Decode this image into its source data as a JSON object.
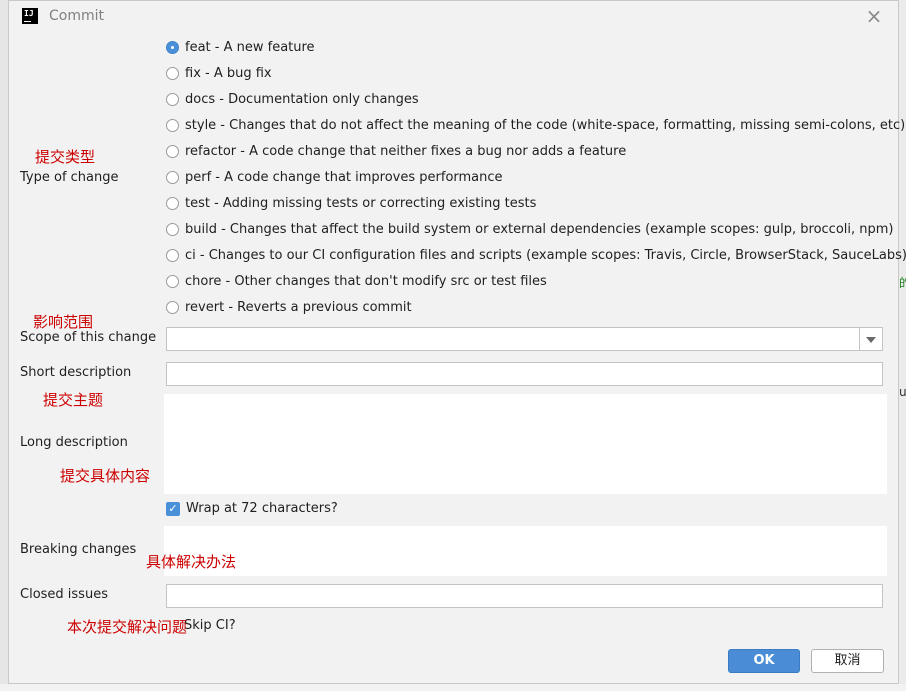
{
  "dialog": {
    "title": "Commit",
    "app_icon_text": "IJ"
  },
  "labels": {
    "type_of_change": "Type of change",
    "scope": "Scope of this change",
    "short_description": "Short description",
    "long_description": "Long description",
    "breaking_changes": "Breaking changes",
    "closed_issues": "Closed issues"
  },
  "annotations": {
    "type": "提交类型",
    "scope": "影响范围",
    "subject": "提交主题",
    "body": "提交具体内容",
    "breaking": "具体解决办法",
    "issues": "本次提交解决问题"
  },
  "change_types": [
    {
      "label": "feat - A new feature",
      "selected": true
    },
    {
      "label": "fix - A bug fix",
      "selected": false
    },
    {
      "label": "docs - Documentation only changes",
      "selected": false
    },
    {
      "label": "style - Changes that do not affect the meaning of the code (white-space, formatting, missing semi-colons, etc)",
      "selected": false
    },
    {
      "label": "refactor - A code change that neither fixes a bug nor adds a feature",
      "selected": false
    },
    {
      "label": "perf - A code change that improves performance",
      "selected": false
    },
    {
      "label": "test - Adding missing tests or correcting existing tests",
      "selected": false
    },
    {
      "label": "build - Changes that affect the build system or external dependencies (example scopes: gulp, broccoli, npm)",
      "selected": false
    },
    {
      "label": "ci - Changes to our CI configuration files and scripts (example scopes: Travis, Circle, BrowserStack, SauceLabs)",
      "selected": false
    },
    {
      "label": "chore - Other changes that don't modify src or test files",
      "selected": false
    },
    {
      "label": "revert - Reverts a previous commit",
      "selected": false
    }
  ],
  "fields": {
    "scope_value": "",
    "short_description_value": "",
    "long_description_value": "",
    "breaking_changes_value": "",
    "closed_issues_value": ""
  },
  "wrap": {
    "label": "Wrap at 72 characters?",
    "checked": true
  },
  "skip_ci": {
    "label": "Skip CI?"
  },
  "buttons": {
    "ok": "OK",
    "cancel": "取消"
  },
  "background": {
    "right_glyph_1": "的",
    "right_glyph_2": "u"
  },
  "colors": {
    "accent": "#4a90d9",
    "annotation": "#cc0000"
  }
}
